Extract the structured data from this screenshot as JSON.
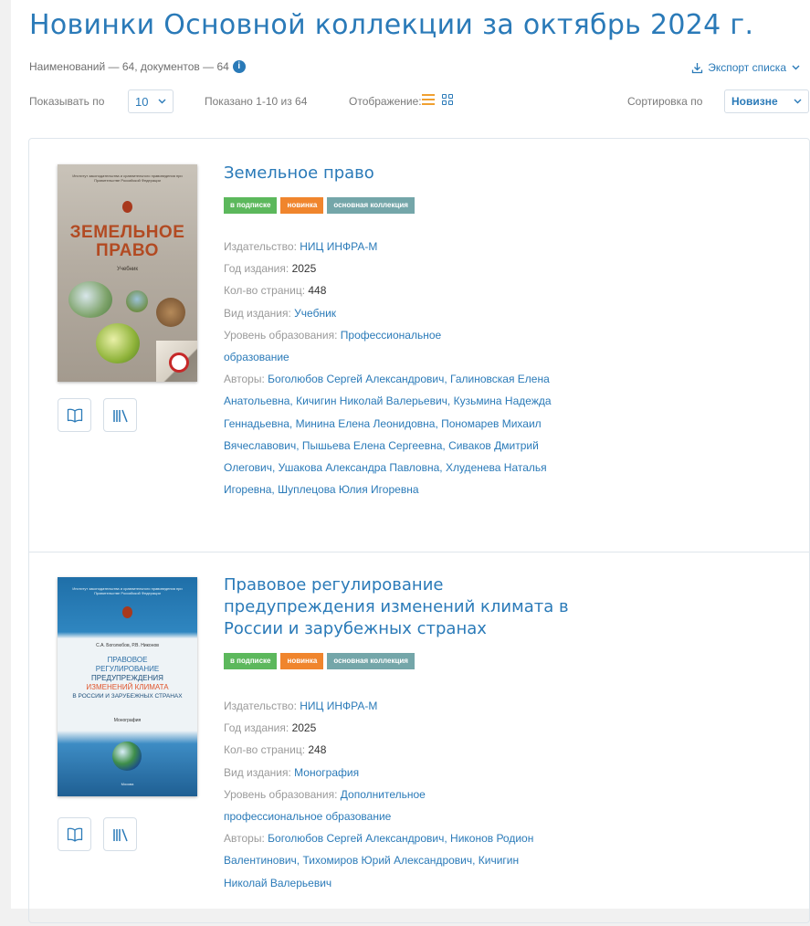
{
  "page_title": "Новинки Основной коллекции за октябрь 2024 г.",
  "stats_text": "Наименований — 64, документов — 64",
  "info_icon": "i",
  "export_label": "Экспорт списка",
  "controls": {
    "show_by_label": "Показывать по",
    "per_page": "10",
    "shown_text": "Показано 1-10 из 64",
    "display_label": "Отображение:",
    "sort_label": "Сортировка по",
    "sort_value": "Новизне"
  },
  "labels": {
    "publisher": "Издательство:",
    "year": "Год издания:",
    "pages": "Кол-во страниц:",
    "type": "Вид издания:",
    "level": "Уровень образования:",
    "authors": "Авторы:"
  },
  "books": [
    {
      "title": "Земельное право",
      "badges": [
        "в подписке",
        "новинка",
        "основная коллекция"
      ],
      "publisher": "НИЦ ИНФРА-М",
      "year": "2025",
      "pages": "448",
      "type": "Учебник",
      "level": "Профессиональное образование",
      "authors": "Боголюбов Сергей Александрович, Галиновская Елена Анатольевна, Кичигин Николай Валерьевич, Кузьмина Надежда Геннадьевна, Минина Елена Леонидовна, Пономарев Михаил Вячеславович, Пышьева Елена Сергеевна, Сиваков Дмитрий Олегович, Ушакова Александра Павловна, Хлуденева Наталья Игоревна, Шуплецова Юлия Игоревна",
      "cover": {
        "publisher_line": "Институт законодательства и сравнительного правоведения при Правительстве Российской Федерации",
        "title_line1": "ЗЕМЕЛЬНОЕ",
        "title_line2": "ПРАВО",
        "subtitle": "Учебник",
        "bg": "#b9b2a7",
        "title_color": "#b24a22"
      }
    },
    {
      "title": "Правовое регулирование предупреждения изменений климата в России и зарубежных странах",
      "badges": [
        "в подписке",
        "новинка",
        "основная коллекция"
      ],
      "publisher": "НИЦ ИНФРА-М",
      "year": "2025",
      "pages": "248",
      "type": "Монография",
      "level": "Дополнительное профессиональное образование",
      "authors": "Боголюбов Сергей Александрович, Никонов Родион Валентинович, Тихомиров Юрий Александрович, Кичигин Николай Валерьевич",
      "cover": {
        "publisher_line": "Институт законодательства и сравнительного правоведения при Правительстве Российской Федерации",
        "authors_line": "С.А. Боголюбов, Р.В. Никонов",
        "title_lines": [
          "ПРАВОВОЕ",
          "РЕГУЛИРОВАНИЕ",
          "ПРЕДУПРЕЖДЕНИЯ"
        ],
        "title_accent": "ИЗМЕНЕНИЙ КЛИМАТА",
        "title_tail": "В РОССИИ И ЗАРУБЕЖНЫХ СТРАНАХ",
        "subtitle": "Монография",
        "city": "Москва",
        "bg": "#2f7fb6"
      }
    }
  ],
  "icons": {
    "read": "open-book-icon",
    "shelf": "bookshelf-icon",
    "export": "download-icon",
    "info": "info-icon",
    "list_view": "list-view-icon",
    "grid_view": "grid-view-icon"
  },
  "colors": {
    "link": "#2a7ab8",
    "badge_green": "#5cb85c",
    "badge_orange": "#f0852d",
    "badge_teal": "#74a6a9",
    "list_view_active": "#f0a030"
  }
}
